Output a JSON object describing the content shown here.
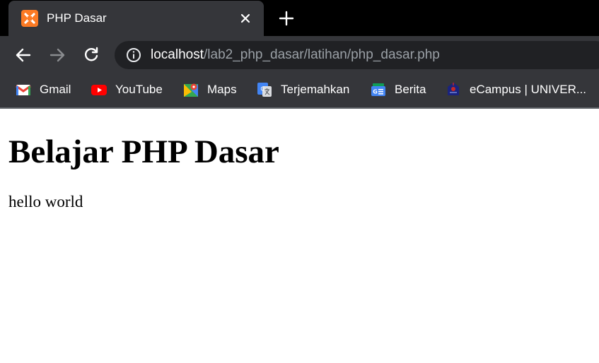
{
  "browser": {
    "tab": {
      "title": "PHP Dasar",
      "favicon": "xampp-icon"
    },
    "address_bar": {
      "host": "localhost",
      "path": "/lab2_php_dasar/latihan/php_dasar.php"
    },
    "bookmarks": [
      {
        "label": "Gmail",
        "icon": "gmail-icon"
      },
      {
        "label": "YouTube",
        "icon": "youtube-icon"
      },
      {
        "label": "Maps",
        "icon": "maps-icon"
      },
      {
        "label": "Terjemahkan",
        "icon": "translate-icon"
      },
      {
        "label": "Berita",
        "icon": "news-icon"
      },
      {
        "label": "eCampus | UNIVER...",
        "icon": "university-icon"
      }
    ]
  },
  "page": {
    "heading": "Belajar PHP Dasar",
    "paragraph": "hello world"
  },
  "colors": {
    "tab_strip": "#000000",
    "toolbar": "#35363a",
    "omnibox": "#202124",
    "url_path": "#9aa0a6",
    "xampp_orange": "#fb7a24"
  }
}
